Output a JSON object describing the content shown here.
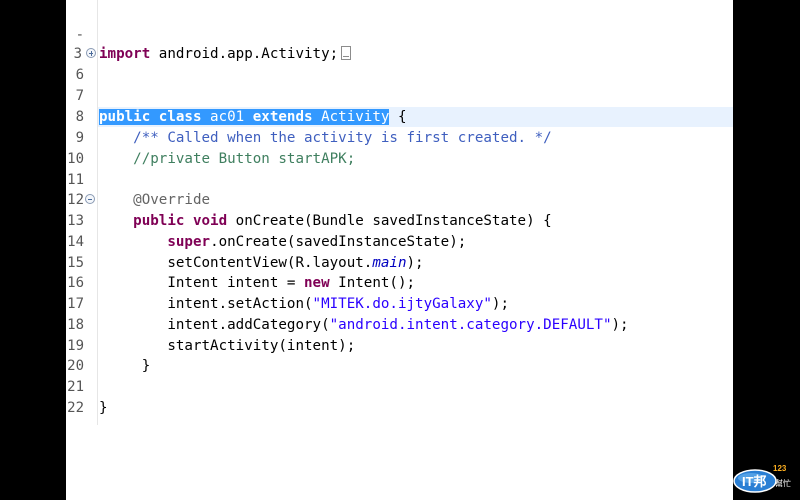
{
  "editor": {
    "colors": {
      "background": "#ffffff",
      "keyword": "#7f0055",
      "javadoc": "#3f5fbf",
      "comment": "#3f7f5f",
      "string": "#2a00ff",
      "field": "#0000c0",
      "selection": "#3399ff",
      "current_line": "#e8f2fe"
    },
    "lines": [
      {
        "num": "-",
        "text": ""
      },
      {
        "num": "3",
        "parts": [
          "import",
          " android.app.Activity;"
        ]
      },
      {
        "num": "6",
        "text": ""
      },
      {
        "num": "7",
        "text": ""
      },
      {
        "num": "8",
        "parts": [
          "public",
          " ",
          "class",
          " ac01 ",
          "extends",
          " Activity",
          " {"
        ]
      },
      {
        "num": "9",
        "parts": [
          "    ",
          "/** Called when the activity is first created. */"
        ]
      },
      {
        "num": "10",
        "parts": [
          "    ",
          "//private Button startAPK;"
        ]
      },
      {
        "num": "11",
        "text": ""
      },
      {
        "num": "12",
        "parts": [
          "    ",
          "@Override"
        ]
      },
      {
        "num": "13",
        "parts": [
          "    ",
          "public",
          " ",
          "void",
          " onCreate(Bundle savedInstanceState) {"
        ]
      },
      {
        "num": "14",
        "parts": [
          "        ",
          "super",
          ".onCreate(savedInstanceState);"
        ]
      },
      {
        "num": "15",
        "parts": [
          "        setContentView(R.layout.",
          "main",
          ");"
        ]
      },
      {
        "num": "16",
        "parts": [
          "        Intent intent = ",
          "new",
          " Intent();"
        ]
      },
      {
        "num": "17",
        "parts": [
          "        intent.setAction(",
          "\"MITEK.do.ijtyGalaxy\"",
          ");"
        ]
      },
      {
        "num": "18",
        "parts": [
          "        intent.addCategory(",
          "\"android.intent.category.DEFAULT\"",
          ");"
        ]
      },
      {
        "num": "19",
        "parts": [
          "        startActivity(intent);"
        ]
      },
      {
        "num": "20",
        "parts": [
          "     }"
        ]
      },
      {
        "num": "21",
        "text": ""
      },
      {
        "num": "22",
        "parts": [
          "}"
        ]
      }
    ]
  },
  "logo": {
    "text": "IT邦",
    "sub": "幫忙",
    "tag": "123"
  }
}
